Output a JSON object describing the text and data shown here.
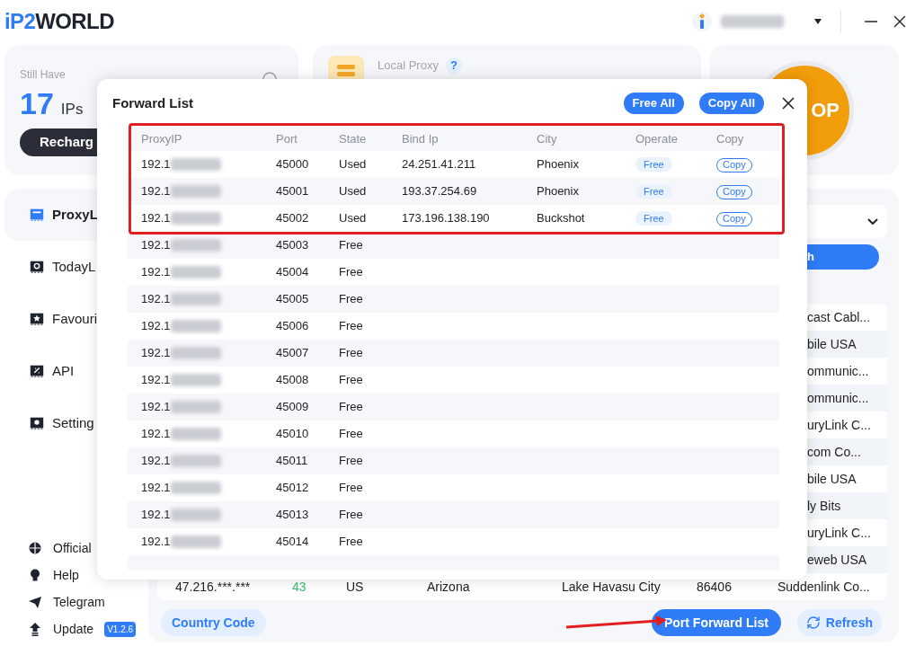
{
  "header": {
    "logo_prefix": "iP2",
    "logo_suffix": "WORLD"
  },
  "balance": {
    "label": "Still Have",
    "count": "17",
    "unit": "IPs",
    "button": "Recharg"
  },
  "local_proxy": {
    "label": "Local Proxy",
    "help": "?"
  },
  "power_button": {
    "label": "OP"
  },
  "sidebar": {
    "items": [
      {
        "label": "ProxyL",
        "selected": true,
        "kind": "list"
      },
      {
        "label": "TodayL",
        "selected": false,
        "kind": "clock"
      },
      {
        "label": "Favouri",
        "selected": false,
        "kind": "star"
      },
      {
        "label": "API",
        "selected": false,
        "kind": "api"
      },
      {
        "label": "Setting",
        "selected": false,
        "kind": "gear"
      }
    ]
  },
  "footer_links": [
    {
      "label": "Official",
      "kind": "globe"
    },
    {
      "label": "Help",
      "kind": "bulb"
    },
    {
      "label": "Telegram",
      "kind": "plane"
    },
    {
      "label": "Update",
      "kind": "update",
      "badge": "V1.2.6"
    }
  ],
  "search_button": {
    "label": "h"
  },
  "proxy_table": {
    "rows": [
      {
        "kind": "partial",
        "isp": "cast Cabl..."
      },
      {
        "kind": "partial",
        "isp": "bile USA"
      },
      {
        "kind": "partial",
        "isp": "ommunic..."
      },
      {
        "kind": "partial",
        "isp": "ommunic..."
      },
      {
        "kind": "partial",
        "isp": "uryLink C..."
      },
      {
        "kind": "partial",
        "isp": "com Co..."
      },
      {
        "kind": "partial",
        "isp": "bile USA"
      },
      {
        "kind": "partial",
        "isp": "ly Bits"
      },
      {
        "kind": "partial",
        "isp": "uryLink C..."
      },
      {
        "kind": "partial",
        "isp": "eweb USA"
      },
      {
        "kind": "full",
        "ip": "47.216.***.***",
        "column_2": "43",
        "country": "US",
        "region": "Arizona",
        "city": "Lake Havasu City",
        "zip": "86406",
        "isp": "Suddenlink Co..."
      }
    ]
  },
  "bottom_buttons": {
    "country_code": "Country Code",
    "port_forward": "Port Forward List",
    "refresh": "Refresh"
  },
  "forward_list": {
    "title": "Forward List",
    "buttons": [
      "Free All",
      "Copy All"
    ],
    "columns": [
      "ProxyIP",
      "Port",
      "State",
      "Bind Ip",
      "City",
      "Operate",
      "Copy"
    ],
    "rows": [
      {
        "proxy_ip": "192.1",
        "port": "45000",
        "state": "Used",
        "bind_ip": "24.251.41.211",
        "city": "Phoenix",
        "operate": "Free",
        "copy": "Copy"
      },
      {
        "proxy_ip": "192.1",
        "port": "45001",
        "state": "Used",
        "bind_ip": "193.37.254.69",
        "city": "Phoenix",
        "operate": "Free",
        "copy": "Copy"
      },
      {
        "proxy_ip": "192.1",
        "port": "45002",
        "state": "Used",
        "bind_ip": "173.196.138.190",
        "city": "Buckshot",
        "operate": "Free",
        "copy": "Copy"
      },
      {
        "proxy_ip": "192.1",
        "port": "45003",
        "state": "Free"
      },
      {
        "proxy_ip": "192.1",
        "port": "45004",
        "state": "Free"
      },
      {
        "proxy_ip": "192.1",
        "port": "45005",
        "state": "Free"
      },
      {
        "proxy_ip": "192.1",
        "port": "45006",
        "state": "Free"
      },
      {
        "proxy_ip": "192.1",
        "port": "45007",
        "state": "Free"
      },
      {
        "proxy_ip": "192.1",
        "port": "45008",
        "state": "Free"
      },
      {
        "proxy_ip": "192.1",
        "port": "45009",
        "state": "Free"
      },
      {
        "proxy_ip": "192.1",
        "port": "45010",
        "state": "Free"
      },
      {
        "proxy_ip": "192.1",
        "port": "45011",
        "state": "Free"
      },
      {
        "proxy_ip": "192.1",
        "port": "45012",
        "state": "Free"
      },
      {
        "proxy_ip": "192.1",
        "port": "45013",
        "state": "Free"
      },
      {
        "proxy_ip": "192.1",
        "port": "45014",
        "state": "Free"
      }
    ]
  }
}
